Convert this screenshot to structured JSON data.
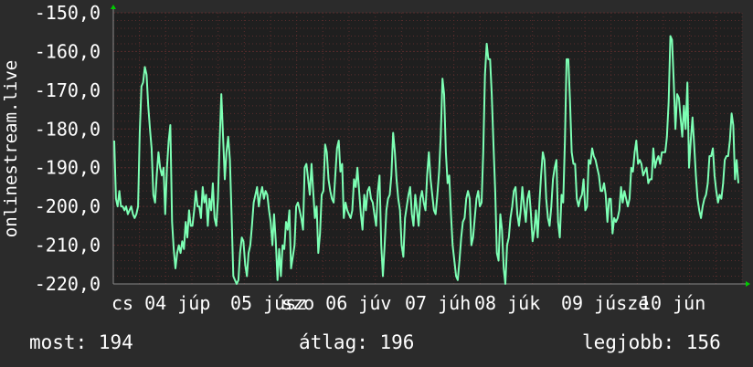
{
  "colors": {
    "background": "#2b2b2b",
    "plot_background": "#1f1f1f",
    "grid": "#5a2d2d",
    "line": "#7dffb4",
    "axis_arrow": "#00cc00",
    "text": "#ffffff"
  },
  "chart_data": {
    "type": "line",
    "title": "",
    "ylabel": "onlinestream.live",
    "xlabel": "",
    "ylim": [
      -220,
      -150
    ],
    "grid": true,
    "y_ticks": [
      "-150,0",
      "-160,0",
      "-170,0",
      "-180,0",
      "-190,0",
      "-200,0",
      "-210,0",
      "-220,0"
    ],
    "x_ticks": [
      "cs 04 júp",
      "05 júsz",
      "szo 06 júv",
      "07 júh",
      "08 júk",
      "09 júsze",
      "10 jún"
    ],
    "series": [
      {
        "values": [
          -183,
          -198,
          -200,
          -196,
          -200,
          -200,
          -201,
          -200,
          -202,
          -201,
          -200,
          -202,
          -203,
          -202,
          -200,
          -181,
          -169,
          -168,
          -164,
          -166,
          -174,
          -180,
          -185,
          -197,
          -199,
          -192,
          -186,
          -190,
          -192,
          -190,
          -202,
          -190,
          -183,
          -179,
          -204,
          -211,
          -216,
          -212,
          -210,
          -212,
          -209,
          -211,
          -204,
          -208,
          -201,
          -205,
          -205,
          -201,
          -196,
          -200,
          -200,
          -203,
          -195,
          -199,
          -197,
          -205,
          -198,
          -201,
          -194,
          -203,
          -205,
          -198,
          -183,
          -171,
          -182,
          -193,
          -186,
          -182,
          -188,
          -202,
          -218,
          -219,
          -220,
          -219,
          -212,
          -208,
          -209,
          -215,
          -218,
          -212,
          -210,
          -205,
          -199,
          -197,
          -195,
          -200,
          -197,
          -195,
          -198,
          -196,
          -197,
          -201,
          -204,
          -210,
          -202,
          -209,
          -219,
          -211,
          -218,
          -210,
          -211,
          -204,
          -206,
          -201,
          -216,
          -213,
          -210,
          -200,
          -199,
          -201,
          -203,
          -206,
          -190,
          -189,
          -193,
          -197,
          -189,
          -196,
          -203,
          -200,
          -212,
          -207,
          -197,
          -196,
          -184,
          -186,
          -193,
          -196,
          -198,
          -199,
          -192,
          -185,
          -183,
          -191,
          -189,
          -203,
          -199,
          -201,
          -202,
          -203,
          -201,
          -193,
          -195,
          -190,
          -196,
          -202,
          -206,
          -197,
          -201,
          -196,
          -195,
          -198,
          -199,
          -202,
          -205,
          -196,
          -192,
          -210,
          -218,
          -210,
          -201,
          -198,
          -197,
          -192,
          -181,
          -186,
          -193,
          -198,
          -201,
          -210,
          -213,
          -203,
          -200,
          -197,
          -195,
          -202,
          -205,
          -197,
          -201,
          -205,
          -198,
          -196,
          -199,
          -201,
          -192,
          -186,
          -193,
          -197,
          -201,
          -202,
          -197,
          -191,
          -182,
          -167,
          -171,
          -186,
          -194,
          -192,
          -202,
          -210,
          -214,
          -218,
          -219,
          -214,
          -208,
          -204,
          -203,
          -198,
          -196,
          -198,
          -210,
          -208,
          -203,
          -198,
          -196,
          -200,
          -199,
          -186,
          -166,
          -158,
          -162,
          -162,
          -171,
          -184,
          -196,
          -212,
          -214,
          -202,
          -206,
          -216,
          -220,
          -210,
          -208,
          -203,
          -200,
          -196,
          -195,
          -202,
          -205,
          -201,
          -195,
          -200,
          -204,
          -198,
          -196,
          -202,
          -209,
          -206,
          -201,
          -208,
          -199,
          -192,
          -186,
          -188,
          -198,
          -203,
          -205,
          -200,
          -193,
          -190,
          -188,
          -204,
          -208,
          -197,
          -199,
          -183,
          -162,
          -162,
          -173,
          -186,
          -189,
          -189,
          -198,
          -200,
          -198,
          -197,
          -193,
          -201,
          -200,
          -188,
          -189,
          -185,
          -187,
          -188,
          -190,
          -192,
          -196,
          -196,
          -194,
          -197,
          -204,
          -198,
          -198,
          -207,
          -203,
          -204,
          -203,
          -201,
          -195,
          -199,
          -196,
          -198,
          -200,
          -198,
          -190,
          -191,
          -186,
          -183,
          -189,
          -188,
          -189,
          -192,
          -191,
          -190,
          -194,
          -193,
          -193,
          -185,
          -190,
          -188,
          -187,
          -189,
          -186,
          -186,
          -186,
          -182,
          -173,
          -156,
          -157,
          -168,
          -180,
          -171,
          -172,
          -177,
          -182,
          -174,
          -180,
          -168,
          -190,
          -183,
          -177,
          -184,
          -192,
          -198,
          -201,
          -203,
          -200,
          -198,
          -197,
          -194,
          -187,
          -187,
          -185,
          -192,
          -196,
          -199,
          -197,
          -198,
          -194,
          -188,
          -187,
          -187,
          -183,
          -176,
          -179,
          -193,
          -188,
          -194
        ]
      }
    ]
  },
  "footer": {
    "now": "most: 194",
    "avg": "átlag: 196",
    "best": "legjobb: 156"
  }
}
